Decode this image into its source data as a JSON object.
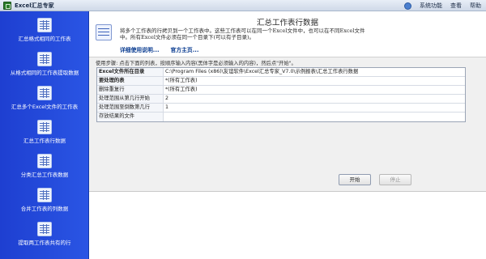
{
  "window": {
    "title": "Excel汇总专家",
    "menu": [
      "系统功能",
      "查看",
      "帮助"
    ]
  },
  "sidebar": {
    "items": [
      {
        "label": "汇总格式相同的工作表",
        "icon": "sheet-grid-icon"
      },
      {
        "label": "从格式相同的工作表提取数据",
        "icon": "sheet-grid-icon"
      },
      {
        "label": "汇总多个Excel文件的工作表",
        "icon": "sheet-grid-icon"
      },
      {
        "label": "汇总工作表行数据",
        "icon": "sheet-grid-icon"
      },
      {
        "label": "分类汇总工作表数据",
        "icon": "sheet-grid-icon"
      },
      {
        "label": "合并工作表的列数据",
        "icon": "sheet-grid-icon"
      },
      {
        "label": "提取两工作表共有的行",
        "icon": "sheet-grid-icon"
      }
    ]
  },
  "header": {
    "title": "汇总工作表行数据",
    "description_line1": "将多个工作表的行拷贝到一个工作表中。这些工作表可以在同一个Excel文件中，也可以在不同Excel文件",
    "description_line2": "中。所有Excel文件必须在同一个目录下(可以有子目录)。",
    "link_details": "详细使用说明...",
    "link_homepage": "官方主页..."
  },
  "form": {
    "usage_hint": "使用步骤: 点击下面的列表，按顺序输入内容(黑体字是必须输入的内容)，然后点\"开始\"。",
    "rows": [
      {
        "label": "Excel文件所在目录",
        "value": "C:\\Program Files (x86)\\友谊软件\\Excel汇总专家_V7.0\\示例报表\\汇总工作表行数据"
      },
      {
        "label": "要处理的表",
        "value": "*(所有工作表)"
      },
      {
        "label": "删除重复行",
        "value": "*(所有工作表)"
      },
      {
        "label": "处理范围从第几行开始",
        "value": "2"
      },
      {
        "label": "处理范围至倒数第几行",
        "value": "1"
      },
      {
        "label": "存放结果的文件",
        "value": ""
      }
    ],
    "start_label": "开始",
    "stop_label": "停止"
  }
}
